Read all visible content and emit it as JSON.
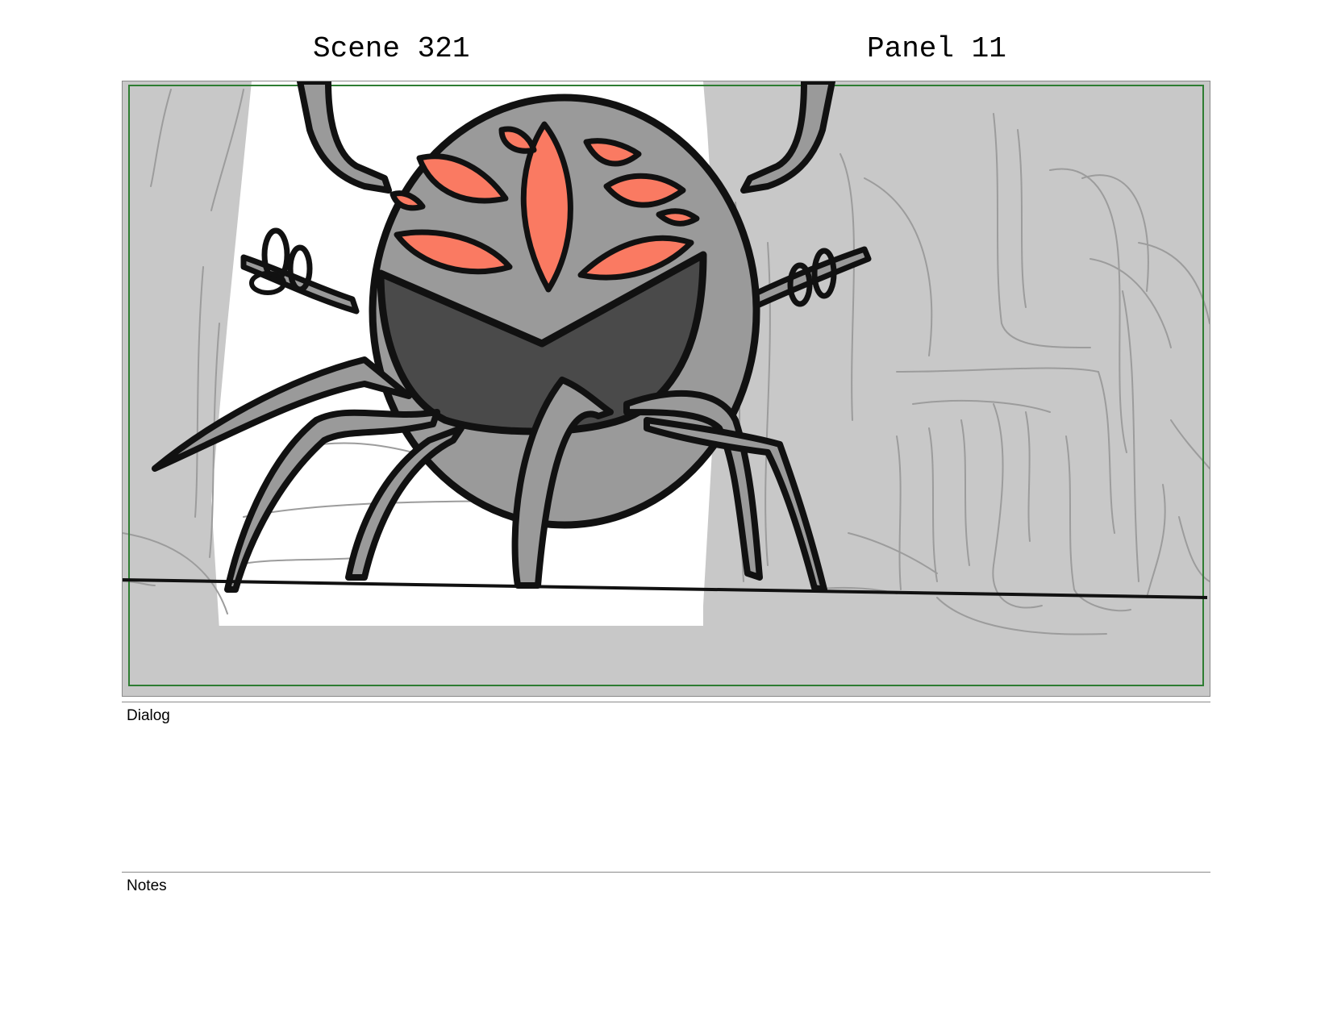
{
  "header": {
    "scene_label": "Scene 321",
    "panel_label": "Panel 11"
  },
  "sections": {
    "dialog_label": "Dialog",
    "dialog_text": "",
    "notes_label": "Notes",
    "notes_text": ""
  },
  "colors": {
    "safe_area_border": "#2e7d32",
    "body_gray": "#9a9a9a",
    "face_dark": "#4a4a4a",
    "markings": "#fa7a62",
    "background_gray": "#c8c8c8"
  }
}
